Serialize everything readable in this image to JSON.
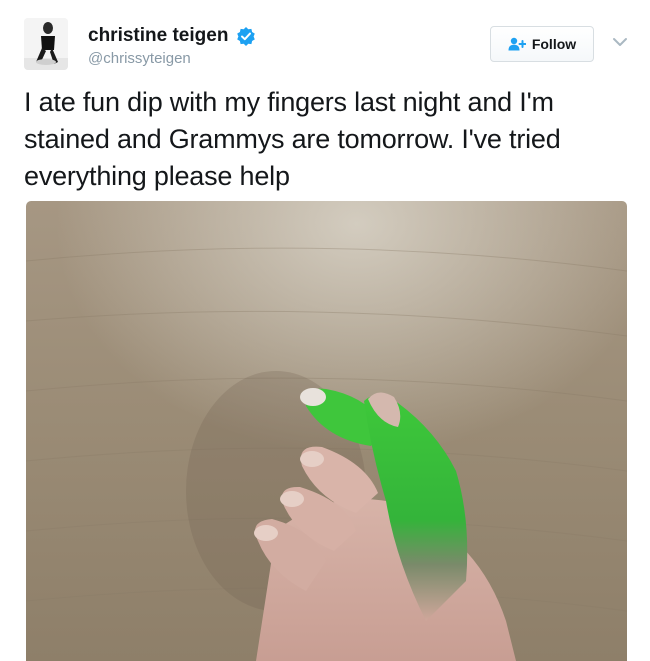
{
  "user": {
    "display_name": "christine teigen",
    "handle": "@chrissyteigen",
    "verified": true,
    "verified_icon": "verified-badge-icon",
    "avatar": "avatar-photo"
  },
  "actions": {
    "follow_label": "Follow",
    "follow_icon": "add-user-icon",
    "menu_icon": "chevron-down-icon"
  },
  "tweet": {
    "text": "I ate fun dip with my fingers last night and I'm stained and Grammys are tomorrow. I've tried everything please help"
  },
  "media": {
    "type": "photo",
    "subject": "hand-with-green-stained-fingertips"
  },
  "colors": {
    "verified_blue": "#1da1f2",
    "handle_gray": "#8899a6",
    "text": "#14171a",
    "stain_green": "#3ec83a"
  }
}
